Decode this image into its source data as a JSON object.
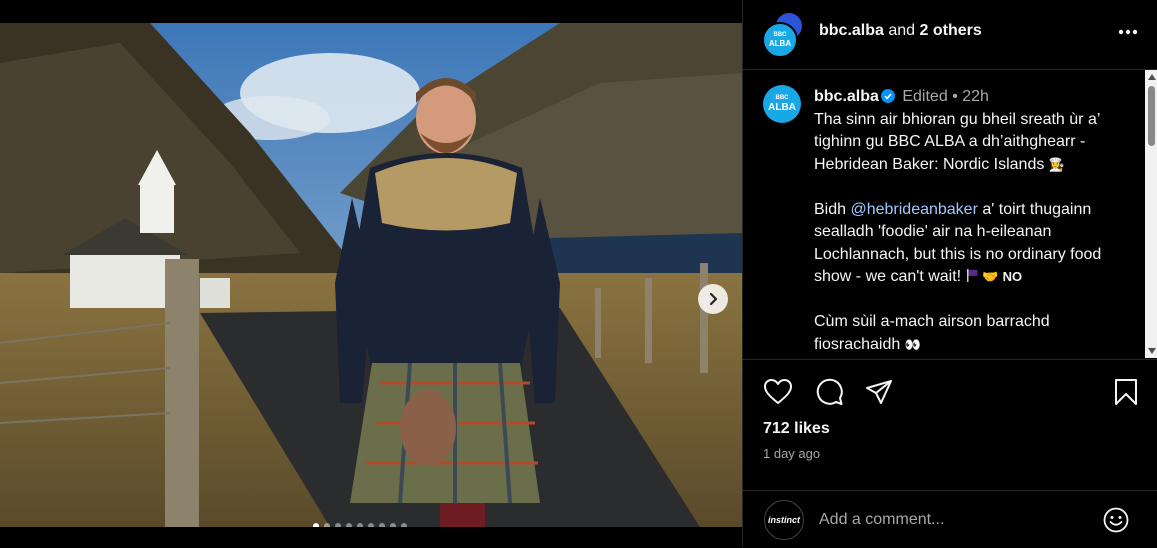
{
  "post": {
    "header": {
      "author": "bbc.alba",
      "joiner": "and",
      "others": "2 others",
      "avatar_text_top": "BBC",
      "avatar_text_bottom": "ALBA"
    },
    "caption": {
      "username": "bbc.alba",
      "edited": "Edited",
      "separator": "•",
      "time": "22h",
      "line1": "Tha sinn air bhioran gu bheil sreath ùr a’ tighinn gu BBC ALBA a dh’aithghearr - Hebridean Baker: Nordic Islands",
      "line1_emoji": "👩‍🍳",
      "line2_pre": "Bidh ",
      "mention": "@hebrideanbaker",
      "line2_post": " a' toirt thugainn sealladh 'foodie' air na h-eileanan Lochlannach, but this is no ordinary food show - we can't wait!",
      "line2_emoji": "🤝",
      "line2_tail": "NO",
      "line3": "Cùm sùil a-mach airson barrachd fiosrachaidh",
      "line3_emoji": "👀"
    },
    "likes": "712 likes",
    "posted": "1 day ago",
    "comment": {
      "placeholder": "Add a comment...",
      "avatar_text": "instinct"
    },
    "carousel": {
      "total": 9,
      "current": 1
    }
  },
  "icons": {
    "like": "heart-icon",
    "comment": "comment-bubble-icon",
    "share": "paper-plane-icon",
    "save": "bookmark-icon",
    "more": "more-horizontal-icon",
    "next": "chevron-right-icon",
    "emoji": "smiley-icon",
    "verified": "verified-badge-icon"
  },
  "colors": {
    "background": "#000000",
    "text": "#f5f5f5",
    "muted": "#a8a8a8",
    "mention": "#a1c6ff",
    "verified": "#0095f6",
    "brand_avatar": "#1aa7e6"
  }
}
